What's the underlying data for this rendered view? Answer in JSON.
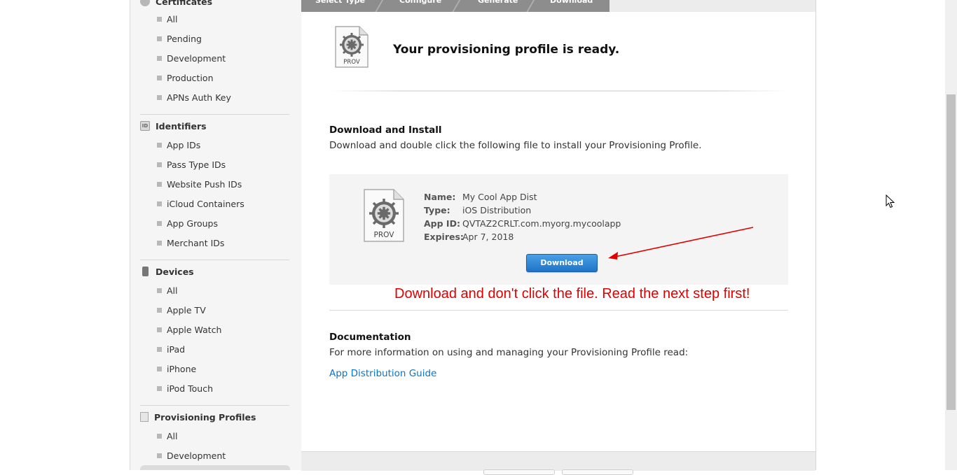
{
  "sidebar": {
    "certificates": {
      "label": "Certificates",
      "items": [
        "All",
        "Pending",
        "Development",
        "Production",
        "APNs Auth Key"
      ]
    },
    "identifiers": {
      "label": "Identifiers",
      "icon_text": "ID",
      "items": [
        "App IDs",
        "Pass Type IDs",
        "Website Push IDs",
        "iCloud Containers",
        "App Groups",
        "Merchant IDs"
      ]
    },
    "devices": {
      "label": "Devices",
      "items": [
        "All",
        "Apple TV",
        "Apple Watch",
        "iPad",
        "iPhone",
        "iPod Touch"
      ]
    },
    "provisioning": {
      "label": "Provisioning Profiles",
      "items": [
        "All",
        "Development"
      ]
    }
  },
  "steps": [
    "Select Type",
    "Configure",
    "Generate",
    "Download"
  ],
  "main": {
    "ready_title": "Your provisioning profile is ready.",
    "prov_icon_label": "PROV",
    "download_install": {
      "heading": "Download and Install",
      "description": "Download and double click the following file to install your Provisioning Profile."
    },
    "profile": {
      "name_key": "Name:",
      "name": "My Cool App Dist",
      "type_key": "Type:",
      "type": "iOS Distribution",
      "app_id_key": "App ID:",
      "app_id": "QVTAZ2CRLT.com.myorg.mycoolapp",
      "expires_key": "Expires:",
      "expires": "Apr 7, 2018",
      "download_label": "Download"
    },
    "annotation": "Download and don't click the file. Read the next step first!",
    "documentation": {
      "heading": "Documentation",
      "description": "For more information on using and managing your Provisioning Profile read:",
      "link": "App Distribution Guide"
    }
  },
  "colors": {
    "link": "#0a74c9",
    "annotation": "#e00000",
    "button": "#1e73c7"
  },
  "icons": [
    "gear-icon",
    "id-icon",
    "device-icon",
    "document-icon",
    "prov-file-icon",
    "red-arrow-icon",
    "mouse-cursor-icon"
  ]
}
